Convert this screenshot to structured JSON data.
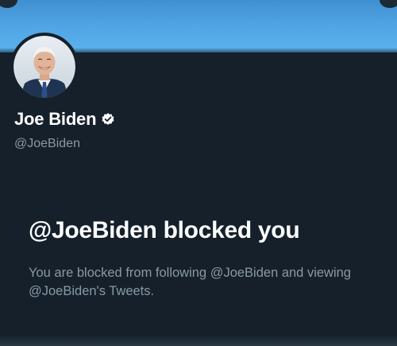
{
  "profile": {
    "name": "Joe Biden",
    "handle": "@JoeBiden",
    "verified_icon": "verified-badge-icon",
    "avatar_icon": "profile-photo"
  },
  "blocked_notice": {
    "title": "@JoeBiden blocked you",
    "description": "You are blocked from following @JoeBiden and viewing @JoeBiden's Tweets."
  },
  "colors": {
    "background": "#15202b",
    "banner": "#4fa3e3",
    "name_text": "#ffffff",
    "secondary_text": "#8899a6"
  }
}
